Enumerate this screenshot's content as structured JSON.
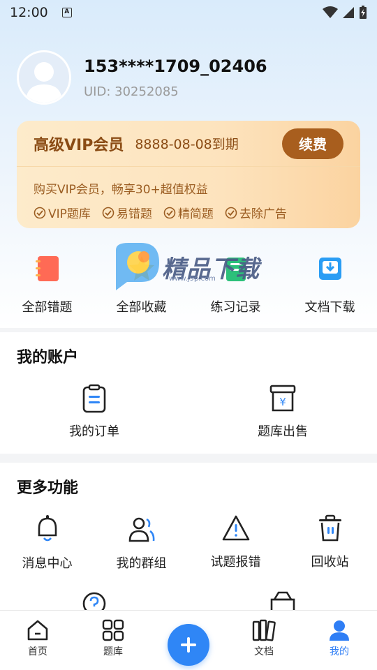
{
  "status_bar": {
    "time": "12:00",
    "notice": "A"
  },
  "profile": {
    "username": "153****1709_02406",
    "uid": "UID: 30252085"
  },
  "vip": {
    "title": "高级VIP会员",
    "expire": "8888-08-08到期",
    "renew_label": "续费",
    "description": "购买VIP会员，畅享30+超值权益",
    "perks": [
      "VIP题库",
      "易错题",
      "精简题",
      "去除广告"
    ]
  },
  "quick_actions": [
    {
      "label": "全部错题",
      "icon": "notebook-icon"
    },
    {
      "label": "全部收藏",
      "icon": "star-icon"
    },
    {
      "label": "练习记录",
      "icon": "record-icon"
    },
    {
      "label": "文档下载",
      "icon": "download-icon"
    }
  ],
  "watermark": {
    "text": "精品下载",
    "sub": "www.j9p.com"
  },
  "account": {
    "title": "我的账户",
    "items": [
      {
        "label": "我的订单",
        "icon": "order-icon"
      },
      {
        "label": "题库出售",
        "icon": "sale-icon"
      }
    ]
  },
  "more": {
    "title": "更多功能",
    "items": [
      {
        "label": "消息中心",
        "icon": "bell-icon"
      },
      {
        "label": "我的群组",
        "icon": "group-icon"
      },
      {
        "label": "试题报错",
        "icon": "warning-icon"
      },
      {
        "label": "回收站",
        "icon": "trash-icon"
      }
    ]
  },
  "tabbar": {
    "items": [
      {
        "label": "首页",
        "icon": "home-icon"
      },
      {
        "label": "题库",
        "icon": "grid-icon"
      },
      {
        "label": "",
        "icon": "plus-icon"
      },
      {
        "label": "文档",
        "icon": "document-icon"
      },
      {
        "label": "我的",
        "icon": "user-icon"
      }
    ],
    "active_color": "#2f7ef5"
  },
  "colors": {
    "primary": "#2f86f6",
    "vip_brown": "#a85e1e",
    "vip_text": "#8a4b14"
  }
}
